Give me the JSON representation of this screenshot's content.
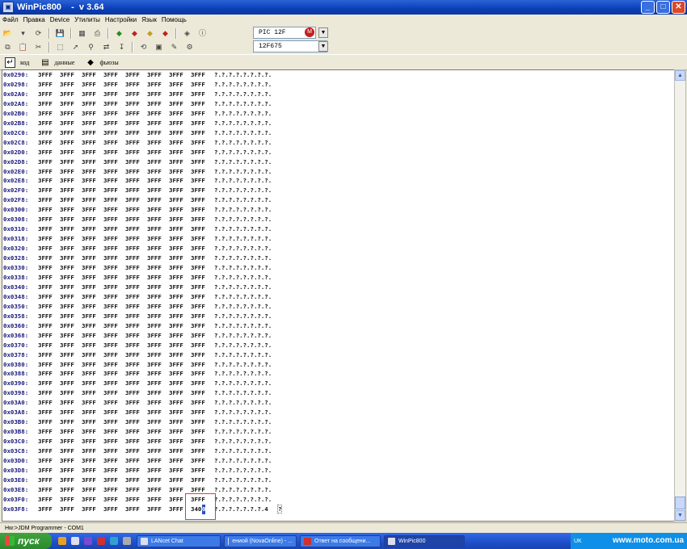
{
  "window": {
    "title": "WinPic800    -  v 3.64",
    "app_icon": "chip-icon",
    "minimize": "_",
    "maximize": "□",
    "close": "✕"
  },
  "menu": [
    "Файл",
    "Правка",
    "Device",
    "Утилиты",
    "Настройки",
    "Язык",
    "Помощь"
  ],
  "device": {
    "family": "PIC 12F",
    "model": "12F675"
  },
  "tabs": [
    {
      "label": "код",
      "icon": "code-icon",
      "active": true
    },
    {
      "label": "данные",
      "icon": "data-icon",
      "active": false
    },
    {
      "label": "фьюзы",
      "icon": "fuse-icon",
      "active": false
    }
  ],
  "memory": {
    "rows": [
      {
        "addr": "0x0290:",
        "words": [
          "3FFF",
          "3FFF",
          "3FFF",
          "3FFF",
          "3FFF",
          "3FFF",
          "3FFF",
          "3FFF"
        ],
        "ascii": "?.?.?.?.?.?.?.?."
      },
      {
        "addr": "0x0298:",
        "words": [
          "3FFF",
          "3FFF",
          "3FFF",
          "3FFF",
          "3FFF",
          "3FFF",
          "3FFF",
          "3FFF"
        ],
        "ascii": "?.?.?.?.?.?.?.?."
      },
      {
        "addr": "0x02A0:",
        "words": [
          "3FFF",
          "3FFF",
          "3FFF",
          "3FFF",
          "3FFF",
          "3FFF",
          "3FFF",
          "3FFF"
        ],
        "ascii": "?.?.?.?.?.?.?.?."
      },
      {
        "addr": "0x02A8:",
        "words": [
          "3FFF",
          "3FFF",
          "3FFF",
          "3FFF",
          "3FFF",
          "3FFF",
          "3FFF",
          "3FFF"
        ],
        "ascii": "?.?.?.?.?.?.?.?."
      },
      {
        "addr": "0x02B0:",
        "words": [
          "3FFF",
          "3FFF",
          "3FFF",
          "3FFF",
          "3FFF",
          "3FFF",
          "3FFF",
          "3FFF"
        ],
        "ascii": "?.?.?.?.?.?.?.?."
      },
      {
        "addr": "0x02B8:",
        "words": [
          "3FFF",
          "3FFF",
          "3FFF",
          "3FFF",
          "3FFF",
          "3FFF",
          "3FFF",
          "3FFF"
        ],
        "ascii": "?.?.?.?.?.?.?.?."
      },
      {
        "addr": "0x02C0:",
        "words": [
          "3FFF",
          "3FFF",
          "3FFF",
          "3FFF",
          "3FFF",
          "3FFF",
          "3FFF",
          "3FFF"
        ],
        "ascii": "?.?.?.?.?.?.?.?."
      },
      {
        "addr": "0x02C8:",
        "words": [
          "3FFF",
          "3FFF",
          "3FFF",
          "3FFF",
          "3FFF",
          "3FFF",
          "3FFF",
          "3FFF"
        ],
        "ascii": "?.?.?.?.?.?.?.?."
      },
      {
        "addr": "0x02D0:",
        "words": [
          "3FFF",
          "3FFF",
          "3FFF",
          "3FFF",
          "3FFF",
          "3FFF",
          "3FFF",
          "3FFF"
        ],
        "ascii": "?.?.?.?.?.?.?.?."
      },
      {
        "addr": "0x02D8:",
        "words": [
          "3FFF",
          "3FFF",
          "3FFF",
          "3FFF",
          "3FFF",
          "3FFF",
          "3FFF",
          "3FFF"
        ],
        "ascii": "?.?.?.?.?.?.?.?."
      },
      {
        "addr": "0x02E0:",
        "words": [
          "3FFF",
          "3FFF",
          "3FFF",
          "3FFF",
          "3FFF",
          "3FFF",
          "3FFF",
          "3FFF"
        ],
        "ascii": "?.?.?.?.?.?.?.?."
      },
      {
        "addr": "0x02E8:",
        "words": [
          "3FFF",
          "3FFF",
          "3FFF",
          "3FFF",
          "3FFF",
          "3FFF",
          "3FFF",
          "3FFF"
        ],
        "ascii": "?.?.?.?.?.?.?.?."
      },
      {
        "addr": "0x02F0:",
        "words": [
          "3FFF",
          "3FFF",
          "3FFF",
          "3FFF",
          "3FFF",
          "3FFF",
          "3FFF",
          "3FFF"
        ],
        "ascii": "?.?.?.?.?.?.?.?."
      },
      {
        "addr": "0x02F8:",
        "words": [
          "3FFF",
          "3FFF",
          "3FFF",
          "3FFF",
          "3FFF",
          "3FFF",
          "3FFF",
          "3FFF"
        ],
        "ascii": "?.?.?.?.?.?.?.?."
      },
      {
        "addr": "0x0300:",
        "words": [
          "3FFF",
          "3FFF",
          "3FFF",
          "3FFF",
          "3FFF",
          "3FFF",
          "3FFF",
          "3FFF"
        ],
        "ascii": "?.?.?.?.?.?.?.?."
      },
      {
        "addr": "0x0308:",
        "words": [
          "3FFF",
          "3FFF",
          "3FFF",
          "3FFF",
          "3FFF",
          "3FFF",
          "3FFF",
          "3FFF"
        ],
        "ascii": "?.?.?.?.?.?.?.?."
      },
      {
        "addr": "0x0310:",
        "words": [
          "3FFF",
          "3FFF",
          "3FFF",
          "3FFF",
          "3FFF",
          "3FFF",
          "3FFF",
          "3FFF"
        ],
        "ascii": "?.?.?.?.?.?.?.?."
      },
      {
        "addr": "0x0318:",
        "words": [
          "3FFF",
          "3FFF",
          "3FFF",
          "3FFF",
          "3FFF",
          "3FFF",
          "3FFF",
          "3FFF"
        ],
        "ascii": "?.?.?.?.?.?.?.?."
      },
      {
        "addr": "0x0320:",
        "words": [
          "3FFF",
          "3FFF",
          "3FFF",
          "3FFF",
          "3FFF",
          "3FFF",
          "3FFF",
          "3FFF"
        ],
        "ascii": "?.?.?.?.?.?.?.?."
      },
      {
        "addr": "0x0328:",
        "words": [
          "3FFF",
          "3FFF",
          "3FFF",
          "3FFF",
          "3FFF",
          "3FFF",
          "3FFF",
          "3FFF"
        ],
        "ascii": "?.?.?.?.?.?.?.?."
      },
      {
        "addr": "0x0330:",
        "words": [
          "3FFF",
          "3FFF",
          "3FFF",
          "3FFF",
          "3FFF",
          "3FFF",
          "3FFF",
          "3FFF"
        ],
        "ascii": "?.?.?.?.?.?.?.?."
      },
      {
        "addr": "0x0338:",
        "words": [
          "3FFF",
          "3FFF",
          "3FFF",
          "3FFF",
          "3FFF",
          "3FFF",
          "3FFF",
          "3FFF"
        ],
        "ascii": "?.?.?.?.?.?.?.?."
      },
      {
        "addr": "0x0340:",
        "words": [
          "3FFF",
          "3FFF",
          "3FFF",
          "3FFF",
          "3FFF",
          "3FFF",
          "3FFF",
          "3FFF"
        ],
        "ascii": "?.?.?.?.?.?.?.?."
      },
      {
        "addr": "0x0348:",
        "words": [
          "3FFF",
          "3FFF",
          "3FFF",
          "3FFF",
          "3FFF",
          "3FFF",
          "3FFF",
          "3FFF"
        ],
        "ascii": "?.?.?.?.?.?.?.?."
      },
      {
        "addr": "0x0350:",
        "words": [
          "3FFF",
          "3FFF",
          "3FFF",
          "3FFF",
          "3FFF",
          "3FFF",
          "3FFF",
          "3FFF"
        ],
        "ascii": "?.?.?.?.?.?.?.?."
      },
      {
        "addr": "0x0358:",
        "words": [
          "3FFF",
          "3FFF",
          "3FFF",
          "3FFF",
          "3FFF",
          "3FFF",
          "3FFF",
          "3FFF"
        ],
        "ascii": "?.?.?.?.?.?.?.?."
      },
      {
        "addr": "0x0360:",
        "words": [
          "3FFF",
          "3FFF",
          "3FFF",
          "3FFF",
          "3FFF",
          "3FFF",
          "3FFF",
          "3FFF"
        ],
        "ascii": "?.?.?.?.?.?.?.?."
      },
      {
        "addr": "0x0368:",
        "words": [
          "3FFF",
          "3FFF",
          "3FFF",
          "3FFF",
          "3FFF",
          "3FFF",
          "3FFF",
          "3FFF"
        ],
        "ascii": "?.?.?.?.?.?.?.?."
      },
      {
        "addr": "0x0370:",
        "words": [
          "3FFF",
          "3FFF",
          "3FFF",
          "3FFF",
          "3FFF",
          "3FFF",
          "3FFF",
          "3FFF"
        ],
        "ascii": "?.?.?.?.?.?.?.?."
      },
      {
        "addr": "0x0378:",
        "words": [
          "3FFF",
          "3FFF",
          "3FFF",
          "3FFF",
          "3FFF",
          "3FFF",
          "3FFF",
          "3FFF"
        ],
        "ascii": "?.?.?.?.?.?.?.?."
      },
      {
        "addr": "0x0380:",
        "words": [
          "3FFF",
          "3FFF",
          "3FFF",
          "3FFF",
          "3FFF",
          "3FFF",
          "3FFF",
          "3FFF"
        ],
        "ascii": "?.?.?.?.?.?.?.?."
      },
      {
        "addr": "0x0388:",
        "words": [
          "3FFF",
          "3FFF",
          "3FFF",
          "3FFF",
          "3FFF",
          "3FFF",
          "3FFF",
          "3FFF"
        ],
        "ascii": "?.?.?.?.?.?.?.?."
      },
      {
        "addr": "0x0390:",
        "words": [
          "3FFF",
          "3FFF",
          "3FFF",
          "3FFF",
          "3FFF",
          "3FFF",
          "3FFF",
          "3FFF"
        ],
        "ascii": "?.?.?.?.?.?.?.?."
      },
      {
        "addr": "0x0398:",
        "words": [
          "3FFF",
          "3FFF",
          "3FFF",
          "3FFF",
          "3FFF",
          "3FFF",
          "3FFF",
          "3FFF"
        ],
        "ascii": "?.?.?.?.?.?.?.?."
      },
      {
        "addr": "0x03A0:",
        "words": [
          "3FFF",
          "3FFF",
          "3FFF",
          "3FFF",
          "3FFF",
          "3FFF",
          "3FFF",
          "3FFF"
        ],
        "ascii": "?.?.?.?.?.?.?.?."
      },
      {
        "addr": "0x03A8:",
        "words": [
          "3FFF",
          "3FFF",
          "3FFF",
          "3FFF",
          "3FFF",
          "3FFF",
          "3FFF",
          "3FFF"
        ],
        "ascii": "?.?.?.?.?.?.?.?."
      },
      {
        "addr": "0x03B0:",
        "words": [
          "3FFF",
          "3FFF",
          "3FFF",
          "3FFF",
          "3FFF",
          "3FFF",
          "3FFF",
          "3FFF"
        ],
        "ascii": "?.?.?.?.?.?.?.?."
      },
      {
        "addr": "0x03B8:",
        "words": [
          "3FFF",
          "3FFF",
          "3FFF",
          "3FFF",
          "3FFF",
          "3FFF",
          "3FFF",
          "3FFF"
        ],
        "ascii": "?.?.?.?.?.?.?.?."
      },
      {
        "addr": "0x03C0:",
        "words": [
          "3FFF",
          "3FFF",
          "3FFF",
          "3FFF",
          "3FFF",
          "3FFF",
          "3FFF",
          "3FFF"
        ],
        "ascii": "?.?.?.?.?.?.?.?."
      },
      {
        "addr": "0x03C8:",
        "words": [
          "3FFF",
          "3FFF",
          "3FFF",
          "3FFF",
          "3FFF",
          "3FFF",
          "3FFF",
          "3FFF"
        ],
        "ascii": "?.?.?.?.?.?.?.?."
      },
      {
        "addr": "0x03D0:",
        "words": [
          "3FFF",
          "3FFF",
          "3FFF",
          "3FFF",
          "3FFF",
          "3FFF",
          "3FFF",
          "3FFF"
        ],
        "ascii": "?.?.?.?.?.?.?.?."
      },
      {
        "addr": "0x03D8:",
        "words": [
          "3FFF",
          "3FFF",
          "3FFF",
          "3FFF",
          "3FFF",
          "3FFF",
          "3FFF",
          "3FFF"
        ],
        "ascii": "?.?.?.?.?.?.?.?."
      },
      {
        "addr": "0x03E0:",
        "words": [
          "3FFF",
          "3FFF",
          "3FFF",
          "3FFF",
          "3FFF",
          "3FFF",
          "3FFF",
          "3FFF"
        ],
        "ascii": "?.?.?.?.?.?.?.?."
      },
      {
        "addr": "0x03E8:",
        "words": [
          "3FFF",
          "3FFF",
          "3FFF",
          "3FFF",
          "3FFF",
          "3FFF",
          "3FFF",
          "3FFF"
        ],
        "ascii": "?.?.?.?.?.?.?.?."
      },
      {
        "addr": "0x03F0:",
        "words": [
          "3FFF",
          "3FFF",
          "3FFF",
          "3FFF",
          "3FFF",
          "3FFF",
          "3FFF",
          "3FFF"
        ],
        "ascii": "?.?.?.?.?.?.?.?."
      },
      {
        "addr": "0x03F8:",
        "words": [
          "3FFF",
          "3FFF",
          "3FFF",
          "3FFF",
          "3FFF",
          "3FFF",
          "3FFF",
          "340"
        ],
        "ascii": "?.?.?.?.?.?.?.4"
      }
    ],
    "cursor_char": "0",
    "ascii_cursor": "?"
  },
  "status": {
    "programmer": "Hw:>JDM Programmer - COM1"
  },
  "taskbar": {
    "start_label": "пуск",
    "tasks": [
      {
        "label": "LANcet Chat",
        "active": false
      },
      {
        "label": "ениой (NovaOnline) - ...",
        "active": false
      },
      {
        "label": "Ответ на сообщени...",
        "active": false
      },
      {
        "label": "WinPic800",
        "active": true
      }
    ],
    "tray_lang": "UK",
    "watermark": "www.moto.com.ua"
  },
  "colors": {
    "titlebar": "#0a3fb8",
    "selection": "#2850c8",
    "highlight_box": "#d04040"
  }
}
